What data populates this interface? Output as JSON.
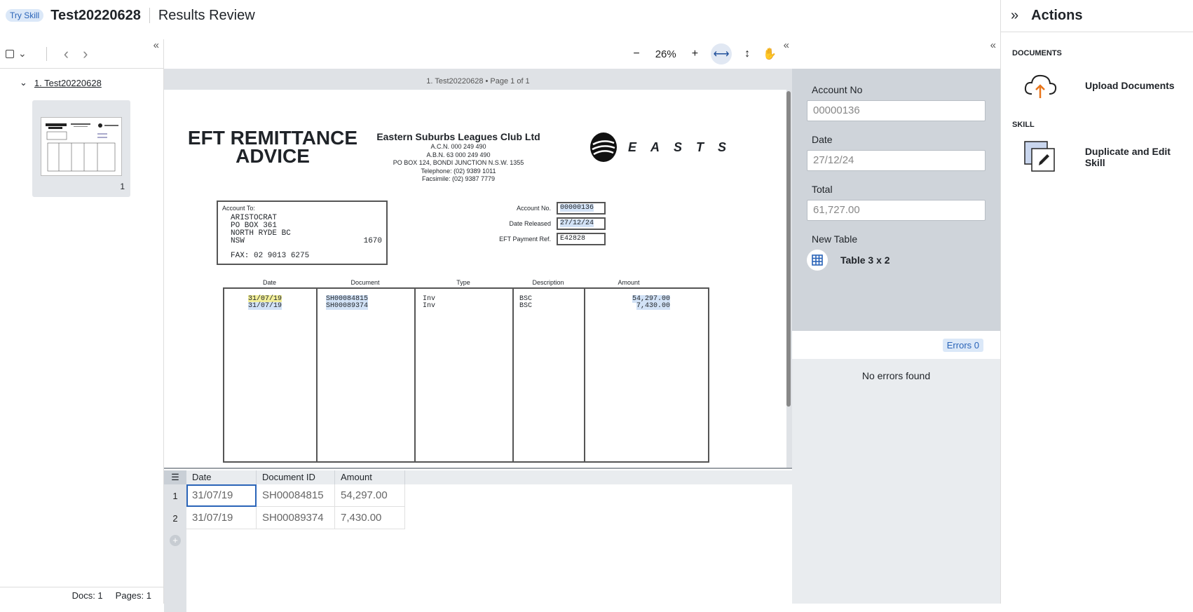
{
  "header": {
    "badge": "Try Skill",
    "doc_title": "Test20220628",
    "page_title": "Results Review"
  },
  "left": {
    "collapse": "«",
    "tree_label": "1. Test20220628",
    "thumb_page": "1",
    "footer_docs": "Docs: 1",
    "footer_pages": "Pages: 1"
  },
  "viewer": {
    "zoom": "26%",
    "collapse": "«",
    "page_label": "1. Test20220628 • Page 1 of 1"
  },
  "document": {
    "title_line1": "EFT REMITTANCE",
    "title_line2": "ADVICE",
    "club_name": "Eastern Suburbs Leagues Club Ltd",
    "club_lines": [
      "A.C.N. 000 249 490",
      "A.B.N. 63 000 249 490",
      "PO BOX 124, BONDI JUNCTION N.S.W. 1355",
      "Telephone: (02) 9389 1011",
      "Facsimile: (02) 9387 7779"
    ],
    "logo_text": "EASTS",
    "account_to_label": "Account To:",
    "address": [
      "ARISTOCRAT",
      "PO BOX 361",
      "NORTH RYDE BC",
      "NSW"
    ],
    "postcode": "1670",
    "fax": "FAX: 02 9013 6275",
    "account_no_label": "Account No.",
    "account_no": "00000136",
    "date_released_label": "Date Released",
    "date_released": "27/12/24",
    "eft_ref_label": "EFT Payment Ref.",
    "eft_ref": "E42828",
    "table_headers": [
      "Date",
      "Document",
      "Type",
      "Description",
      "Amount"
    ],
    "rows": [
      {
        "date": "31/07/19",
        "document": "SH00084815",
        "type": "Inv",
        "description": "BSC",
        "amount": "54,297.00"
      },
      {
        "date": "31/07/19",
        "document": "SH00089374",
        "type": "Inv",
        "description": "BSC",
        "amount": "7,430.00"
      }
    ]
  },
  "grid": {
    "headers": [
      "Date",
      "Document ID",
      "Amount"
    ],
    "rows": [
      {
        "num": "1",
        "date": "31/07/19",
        "doc": "SH00084815",
        "amount": "54,297.00"
      },
      {
        "num": "2",
        "date": "31/07/19",
        "doc": "SH00089374",
        "amount": "7,430.00"
      }
    ]
  },
  "fields": {
    "collapse": "«",
    "account_no_label": "Account No",
    "account_no": "00000136",
    "date_label": "Date",
    "date": "27/12/24",
    "total_label": "Total",
    "total": "61,727.00",
    "new_table_label": "New Table",
    "table_name": "Table 3 x 2",
    "errors_label": "Errors 0",
    "no_errors": "No errors found"
  },
  "actions": {
    "title": "Actions",
    "section_documents": "DOCUMENTS",
    "upload": "Upload Documents",
    "section_skill": "SKILL",
    "duplicate": "Duplicate and Edit Skill",
    "accent": "#e8751a"
  }
}
